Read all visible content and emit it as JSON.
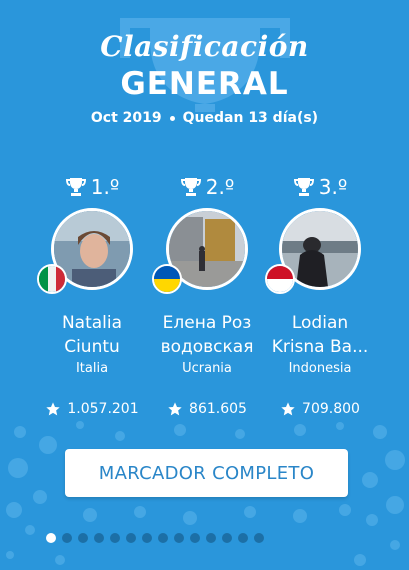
{
  "header": {
    "title_script": "Clasificación",
    "title_main": "GENERAL",
    "period": "Oct 2019",
    "remaining": "Quedan 13 día(s)"
  },
  "podium": [
    {
      "rank": "1.º",
      "first_name": "Natalia",
      "last_name": "Ciuntu",
      "country": "Italia",
      "flag": "italy-flag",
      "score": "1.057.201"
    },
    {
      "rank": "2.º",
      "first_name": "Елена Роз",
      "last_name": "водовская",
      "country": "Ucrania",
      "flag": "ukraine-flag",
      "score": "861.605"
    },
    {
      "rank": "3.º",
      "first_name": "Lodian",
      "last_name": "Krisna Ba...",
      "country": "Indonesia",
      "flag": "indonesia-flag",
      "score": "709.800"
    }
  ],
  "button": {
    "label": "MARCADOR COMPLETO"
  },
  "pager": {
    "active_index": 0,
    "count": 14
  },
  "colors": {
    "background": "#2a96db",
    "button_text": "#2a86c8"
  }
}
